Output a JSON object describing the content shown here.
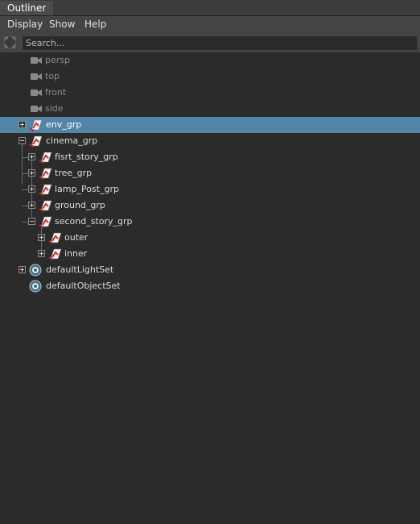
{
  "window": {
    "tab_title": "Outliner"
  },
  "menu": {
    "items": [
      "Display",
      "Show",
      "Help"
    ]
  },
  "search": {
    "placeholder": "Search..."
  },
  "tree": {
    "selected_color": "#5285a6",
    "nodes": [
      {
        "label": "persp",
        "icon": "camera-icon",
        "state": "hidden-camera"
      },
      {
        "label": "top",
        "icon": "camera-icon",
        "state": "hidden-camera"
      },
      {
        "label": "front",
        "icon": "camera-icon",
        "state": "hidden-camera"
      },
      {
        "label": "side",
        "icon": "camera-icon",
        "state": "hidden-camera"
      },
      {
        "label": "env_grp",
        "icon": "group-icon",
        "expander": "collapsed",
        "selected": true
      },
      {
        "label": "cinema_grp",
        "icon": "group-icon",
        "expander": "expanded"
      },
      {
        "label": "fisrt_story_grp",
        "icon": "group-icon",
        "expander": "collapsed"
      },
      {
        "label": "tree_grp",
        "icon": "group-icon",
        "expander": "collapsed"
      },
      {
        "label": "lamp_Post_grp",
        "icon": "group-icon",
        "expander": "collapsed"
      },
      {
        "label": "ground_grp",
        "icon": "group-icon",
        "expander": "collapsed"
      },
      {
        "label": "second_story_grp",
        "icon": "group-icon",
        "expander": "expanded"
      },
      {
        "label": "outer",
        "icon": "group-icon",
        "expander": "collapsed"
      },
      {
        "label": "inner",
        "icon": "group-icon",
        "expander": "collapsed"
      },
      {
        "label": "defaultLightSet",
        "icon": "set-icon",
        "expander": "collapsed"
      },
      {
        "label": "defaultObjectSet",
        "icon": "set-icon"
      }
    ]
  }
}
